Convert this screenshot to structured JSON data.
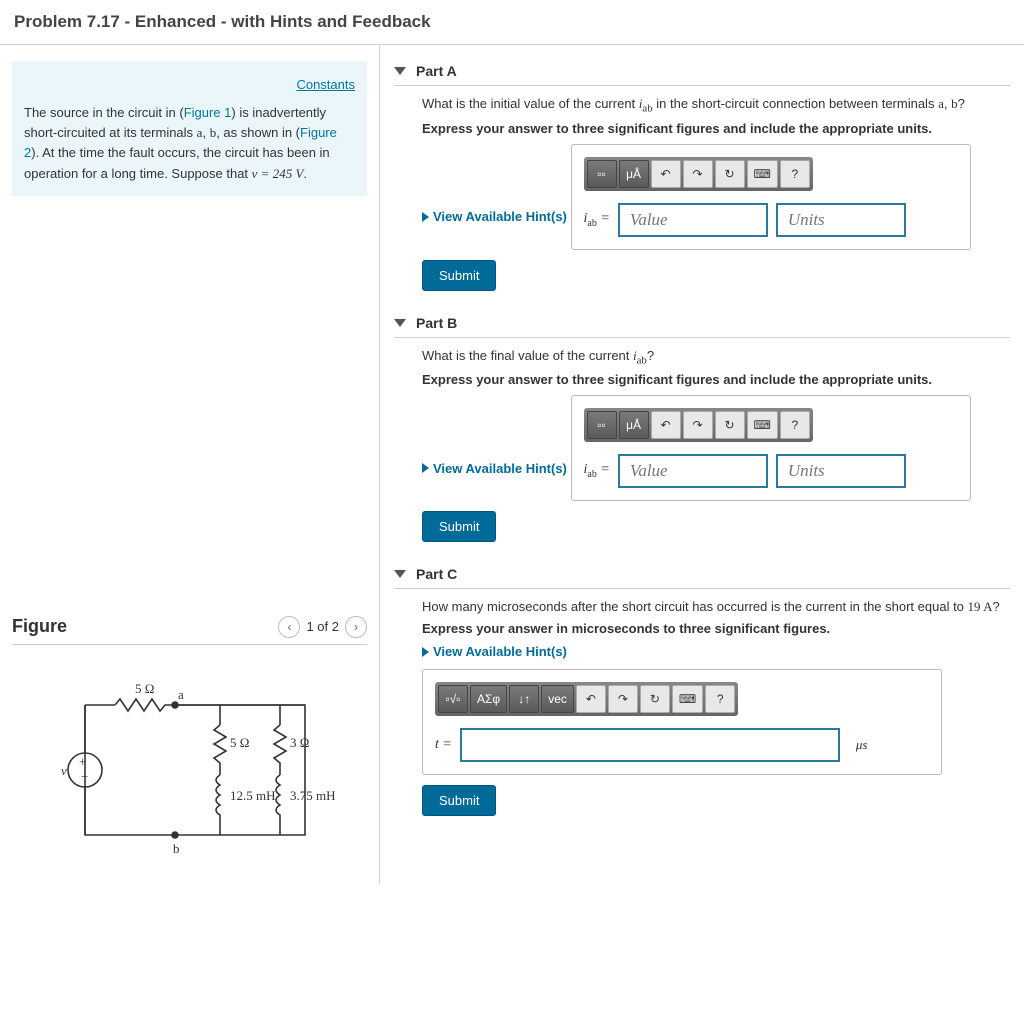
{
  "title": "Problem 7.17 - Enhanced - with Hints and Feedback",
  "constants_link": "Constants",
  "problem_text": {
    "pre1": "The source in the circuit in (",
    "fig1": "Figure 1",
    "mid1": ") is inadvertently short-circuited at its terminals ",
    "a": "a",
    "comma": ", ",
    "b": "b",
    "mid2": ", as shown in (",
    "fig2": "Figure 2",
    "mid3": "). At the time the fault occurs, the circuit has been in operation for a long time. Suppose that ",
    "v_eq": "v = 245 V",
    "period": "."
  },
  "figure": {
    "title": "Figure",
    "pager": "1 of 2",
    "labels": {
      "r1": "5 Ω",
      "r2": "5 Ω",
      "r3": "3 Ω",
      "l1": "12.5 mH",
      "l2": "3.75 mH",
      "a": "a",
      "b": "b",
      "v": "v"
    }
  },
  "parts": {
    "A": {
      "label": "Part A",
      "q_pre": "What is the initial value of the current ",
      "q_var": "i",
      "q_sub": "ab",
      "q_mid": " in the short-circuit connection between terminals ",
      "q_a": "a",
      "q_comma": ", ",
      "q_b": "b",
      "q_end": "?",
      "instruct": "Express your answer to three significant figures and include the appropriate units.",
      "hints": "View Available Hint(s)",
      "var_label": "i",
      "var_sub": "ab",
      "eq": " = ",
      "value_ph": "Value",
      "units_ph": "Units",
      "submit": "Submit",
      "toolbar": {
        "units": "μÅ",
        "help": "?"
      }
    },
    "B": {
      "label": "Part B",
      "q_pre": "What is the final value of the current ",
      "q_var": "i",
      "q_sub": "ab",
      "q_end": "?",
      "instruct": "Express your answer to three significant figures and include the appropriate units.",
      "hints": "View Available Hint(s)",
      "var_label": "i",
      "var_sub": "ab",
      "eq": " = ",
      "value_ph": "Value",
      "units_ph": "Units",
      "submit": "Submit",
      "toolbar": {
        "units": "μÅ",
        "help": "?"
      }
    },
    "C": {
      "label": "Part C",
      "q_pre": "How many microseconds after the short circuit has occurred is the current in the short equal to ",
      "q_val": "19 A",
      "q_end": "?",
      "instruct": "Express your answer in microseconds to three significant figures.",
      "hints": "View Available Hint(s)",
      "var_label": "t",
      "eq": " = ",
      "unit_suffix": "μs",
      "submit": "Submit",
      "toolbar": {
        "greek": "ΑΣφ",
        "sub": "↓↑",
        "vec": "vec",
        "help": "?"
      }
    }
  }
}
